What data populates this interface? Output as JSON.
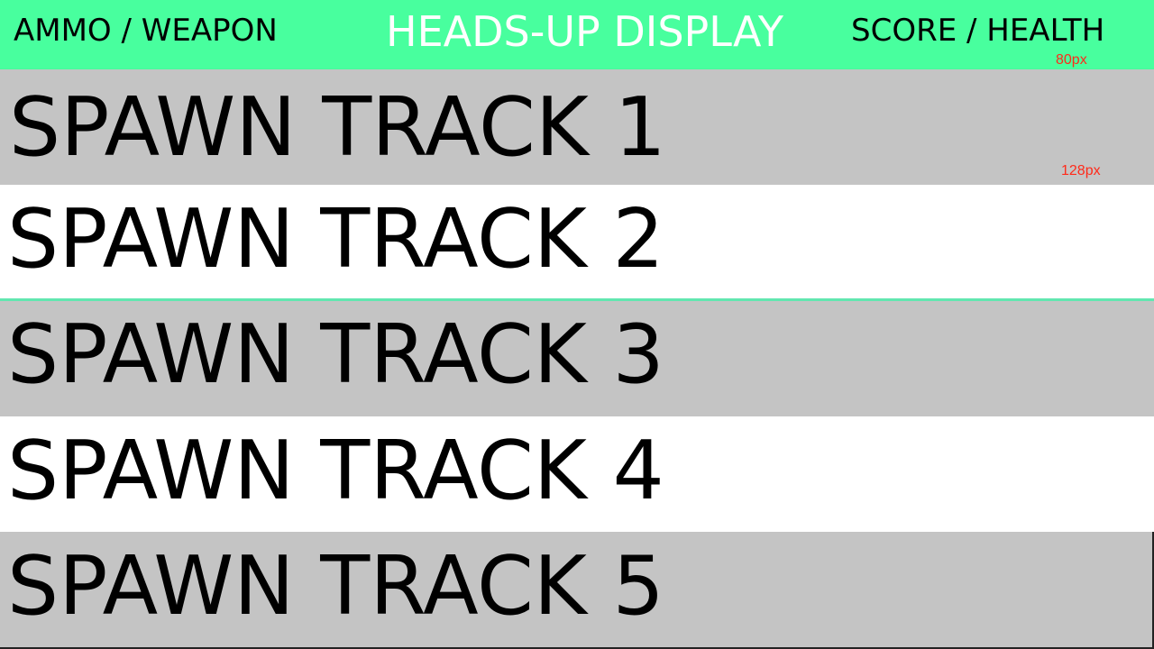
{
  "hud": {
    "left_label": "AMMO / WEAPON",
    "title": "HEADS-UP DISPLAY",
    "right_label": "SCORE / HEALTH",
    "height_label": "80px",
    "background_color": "#48ff9e"
  },
  "tracks": {
    "height_label": "128px",
    "items": [
      {
        "label": "SPAWN TRACK 1",
        "color": "#c4c4c4"
      },
      {
        "label": "SPAWN TRACK 2",
        "color": "#ffffff"
      },
      {
        "label": "SPAWN TRACK 3",
        "color": "#c4c4c4"
      },
      {
        "label": "SPAWN TRACK 4",
        "color": "#ffffff"
      },
      {
        "label": "SPAWN TRACK 5",
        "color": "#c4c4c4"
      }
    ]
  },
  "colors": {
    "dimension_text": "#ff2a1a",
    "separator": "#62e7b0"
  }
}
